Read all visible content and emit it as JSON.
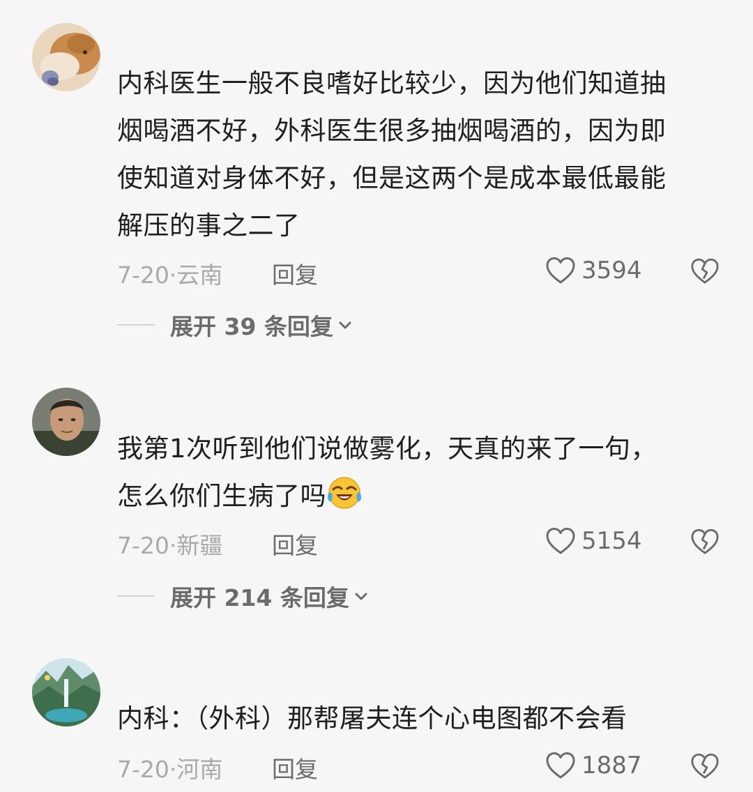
{
  "comments": [
    {
      "avatar": "dog-photo-avatar",
      "text": "内科医生一般不良嗜好比较少，因为他们知道抽烟喝酒不好，外科医生很多抽烟喝酒的，因为即使知道对身体不好，但是这两个是成本最低最能解压的事之二了",
      "lines": [
        "内科医生一般不良嗜好比较少，因为他们知道抽",
        "烟喝酒不好，外科医生很多抽烟喝酒的，因为即",
        "使知道对身体不好，但是这两个是成本最低最能",
        "解压的事之二了"
      ],
      "date": "7-20",
      "location": "云南",
      "reply_label": "回复",
      "likes": "3594",
      "expand_label": "展开 39 条回复"
    },
    {
      "avatar": "man-photo-avatar",
      "lines": [
        "我第1次听到他们说做雾化，天真的来了一句，",
        "怎么你们生病了吗"
      ],
      "emoji": "laughing-crying-emoji",
      "date": "7-20",
      "location": "新疆",
      "reply_label": "回复",
      "likes": "5154",
      "expand_label": "展开 214 条回复"
    },
    {
      "avatar": "landscape-photo-avatar",
      "lines": [
        "内科：（外科）那帮屠夫连个心电图都不会看"
      ],
      "date": "7-20",
      "location": "河南",
      "reply_label": "回复",
      "likes": "1887"
    }
  ],
  "meta_separator": "·"
}
